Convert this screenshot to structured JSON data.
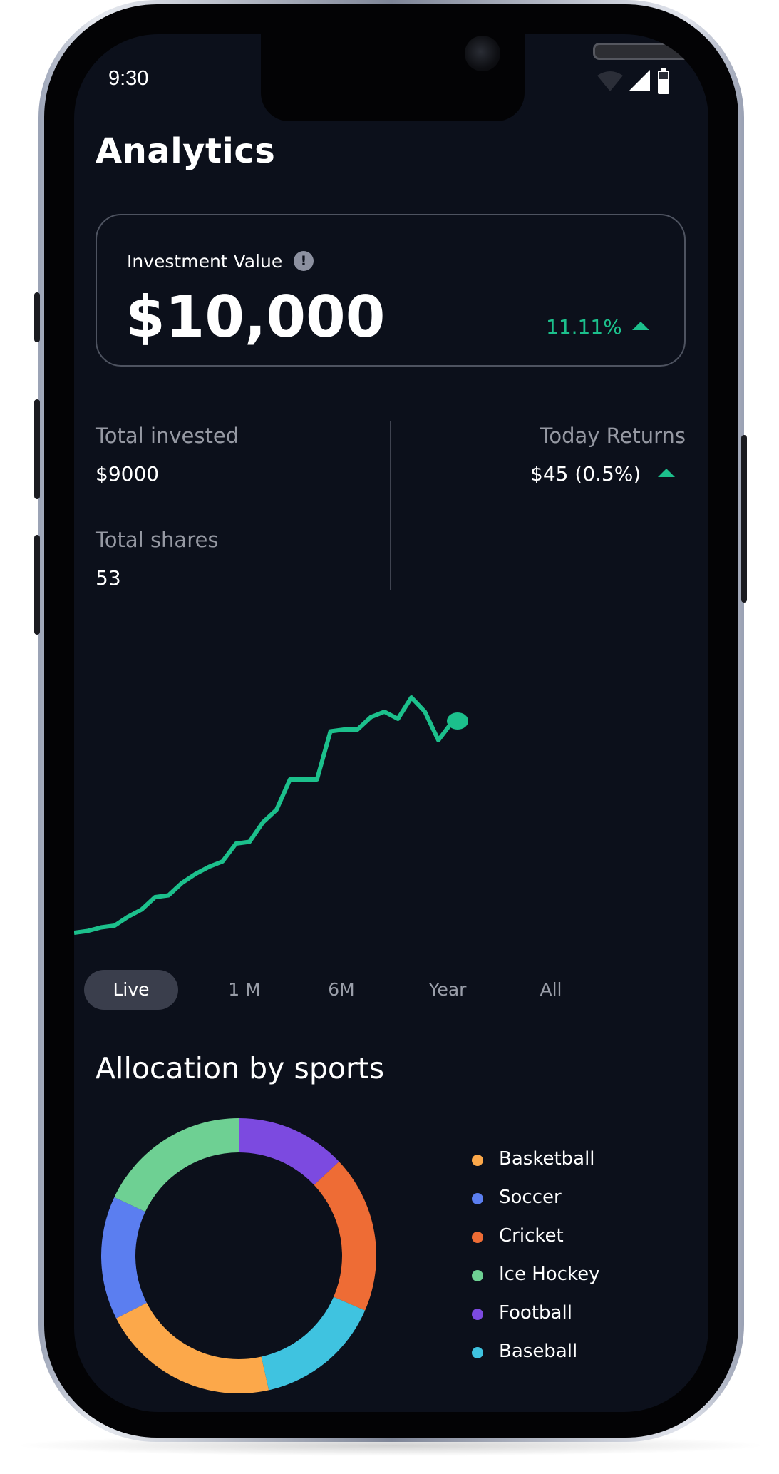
{
  "status_bar": {
    "time": "9:30"
  },
  "page": {
    "title": "Analytics"
  },
  "investment_card": {
    "label": "Investment Value",
    "value": "$10,000",
    "change": "11.11%",
    "change_direction": "up"
  },
  "stats": {
    "total_invested_label": "Total invested",
    "total_invested_value": "$9000",
    "total_shares_label": "Total shares",
    "total_shares_value": "53",
    "today_returns_label": "Today Returns",
    "today_returns_value": "$45 (0.5%)",
    "today_returns_direction": "up"
  },
  "colors": {
    "positive": "#1cc08c",
    "background": "#0c101b",
    "card_border": "#4e5360"
  },
  "chart_data": {
    "type": "line",
    "series": [
      {
        "values": [
          4,
          5,
          7,
          8,
          13,
          17,
          24,
          25,
          32,
          37,
          41,
          44,
          54,
          55,
          66,
          73,
          90,
          90,
          90,
          117,
          118,
          118,
          125,
          128,
          124,
          136,
          128,
          112,
          122
        ]
      }
    ],
    "xlabel": "",
    "ylabel": "",
    "grid": false,
    "line_color": "#1cc08c",
    "end_marker": true
  },
  "time_tabs": {
    "selected": "Live",
    "items": [
      "Live",
      "1 M",
      "6M",
      "Year",
      "All"
    ]
  },
  "allocation": {
    "title": "Allocation by sports",
    "segments": [
      {
        "name": "Football",
        "value": 13,
        "color": "#7c4ae0"
      },
      {
        "name": "Cricket",
        "value": 18.5,
        "color": "#ee6c35"
      },
      {
        "name": "Baseball",
        "value": 15,
        "color": "#3fc3e0"
      },
      {
        "name": "Basketball",
        "value": 21,
        "color": "#fca84a"
      },
      {
        "name": "Soccer",
        "value": 14.5,
        "color": "#5b7ef0"
      },
      {
        "name": "Ice Hockey",
        "value": 18,
        "color": "#6ed093"
      }
    ],
    "legend": [
      {
        "label": "Basketball",
        "color": "#fca84a"
      },
      {
        "label": "Soccer",
        "color": "#5b7ef0"
      },
      {
        "label": "Cricket",
        "color": "#ee6c35"
      },
      {
        "label": "Ice Hockey",
        "color": "#6ed093"
      },
      {
        "label": "Football",
        "color": "#7c4ae0"
      },
      {
        "label": "Baseball",
        "color": "#3fc3e0"
      }
    ]
  }
}
